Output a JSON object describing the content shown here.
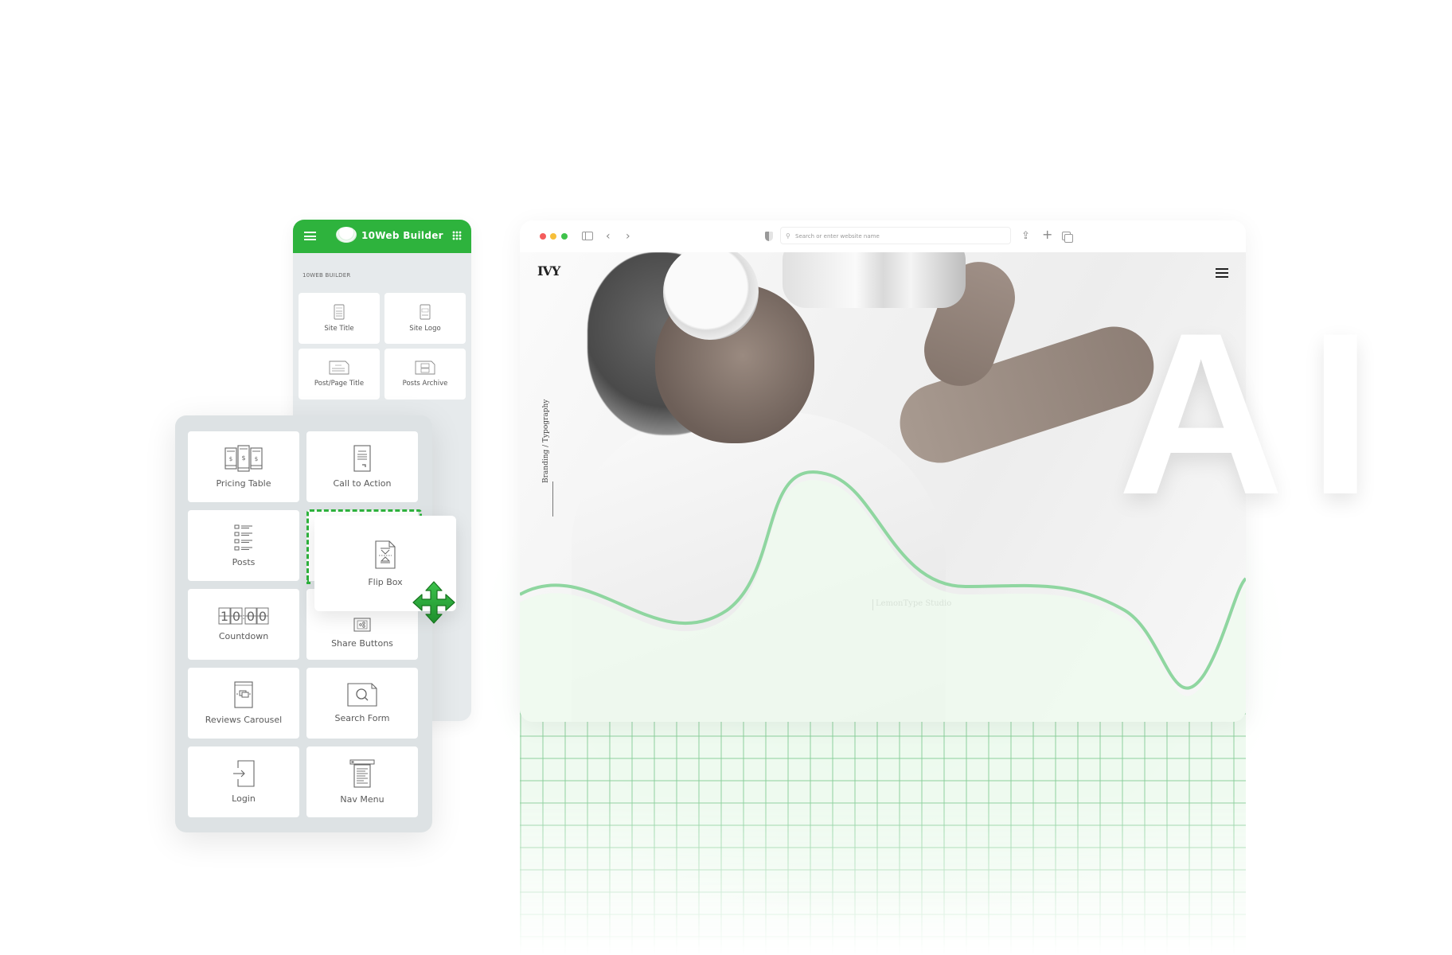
{
  "builder_panel": {
    "title": "10Web Builder",
    "section_label": "10WEB BUILDER",
    "widgets": [
      {
        "label": "Site Title",
        "icon": "site-title-icon"
      },
      {
        "label": "Site Logo",
        "icon": "site-logo-icon"
      },
      {
        "label": "Post/Page Title",
        "icon": "post-title-icon"
      },
      {
        "label": "Posts Archive",
        "icon": "posts-archive-icon"
      }
    ],
    "brand_color": "#2eb33d"
  },
  "widget_panel": {
    "widgets": [
      {
        "label": "Pricing Table",
        "icon": "pricing-table-icon"
      },
      {
        "label": "Call to Action",
        "icon": "call-to-action-icon"
      },
      {
        "label": "Posts",
        "icon": "posts-icon"
      },
      {
        "label": "",
        "icon": ""
      },
      {
        "label": "Countdown",
        "icon": "countdown-icon",
        "display": "10:00"
      },
      {
        "label": "Share Buttons",
        "icon": "share-buttons-icon"
      },
      {
        "label": "Reviews Carousel",
        "icon": "reviews-carousel-icon"
      },
      {
        "label": "Search Form",
        "icon": "search-form-icon"
      },
      {
        "label": "Login",
        "icon": "login-icon"
      },
      {
        "label": "Nav Menu",
        "icon": "nav-menu-icon"
      }
    ],
    "dragging_widget": {
      "label": "Flip Box",
      "icon": "flip-box-icon"
    }
  },
  "browser": {
    "address_placeholder": "Search or enter website name",
    "traffic_lights": {
      "close": "#f45c5c",
      "minimize": "#f7bf3a",
      "maximize": "#3fc24b"
    },
    "site": {
      "logo": "IVY",
      "vertical_caption": "Branding / Typography",
      "studio_credit": "LemonType Studio"
    }
  },
  "hero_text": "AI",
  "accent_green": "#7fcf93"
}
